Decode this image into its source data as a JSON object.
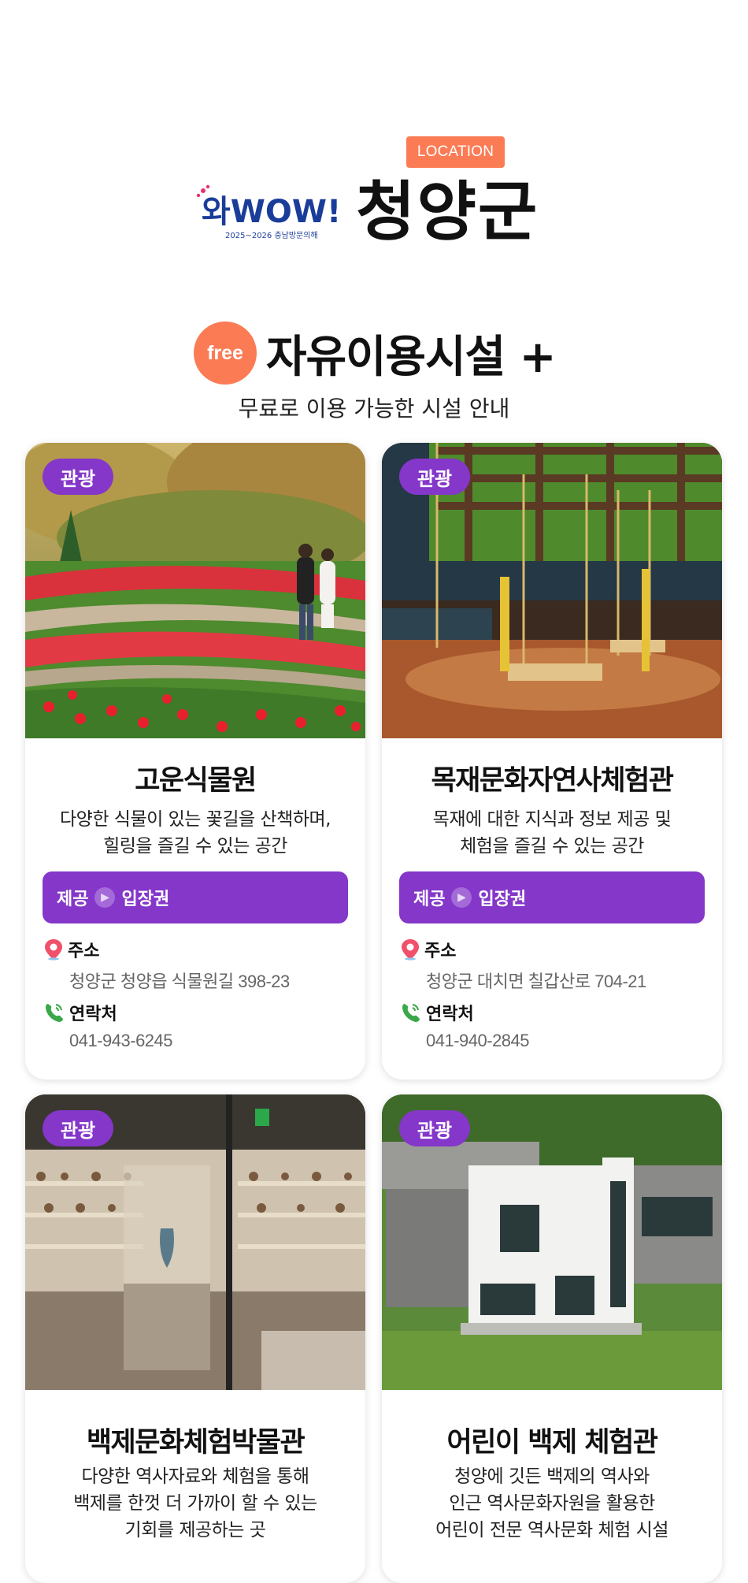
{
  "header": {
    "location_badge": "LOCATION",
    "logo_text": "와WOW!",
    "logo_subtext": "2025~2026 충남방문의해",
    "region": "청양군"
  },
  "section": {
    "free_badge": "free",
    "title": "자유이용시설 +",
    "subtitle": "무료로 이용 가능한 시설 안내"
  },
  "cards": [
    {
      "tag": "관광",
      "title": "고운식물원",
      "desc1": "다양한 식물이 있는 꽃길을 산책하며,",
      "desc2": "힐링을 즐길 수 있는 공간",
      "provide_label": "제공",
      "ticket_label": "입장권",
      "address_label": "주소",
      "address": "청양군 청양읍 식물원길 398-23",
      "phone_label": "연락처",
      "phone": "041-943-6245"
    },
    {
      "tag": "관광",
      "title": "목재문화자연사체험관",
      "desc1": "목재에 대한 지식과 정보 제공 및",
      "desc2": "체험을 즐길 수 있는 공간",
      "provide_label": "제공",
      "ticket_label": "입장권",
      "address_label": "주소",
      "address": "청양군 대치면 칠갑산로 704-21",
      "phone_label": "연락처",
      "phone": "041-940-2845"
    },
    {
      "tag": "관광",
      "title": "백제문화체험박물관",
      "desc1": "다양한 역사자료와 체험을 통해",
      "desc2": "백제를 한껏 더 가까이 할 수 있는",
      "desc3": "기회를 제공하는 곳"
    },
    {
      "tag": "관광",
      "title": "어린이 백제 체험관",
      "desc1": "청양에 깃든 백제의 역사와",
      "desc2": "인근 역사문화자원을 활용한",
      "desc3": "어린이 전문 역사문화 체험 시설"
    }
  ],
  "colors": {
    "accent_orange": "#fb7b55",
    "accent_purple": "#8437c9"
  }
}
